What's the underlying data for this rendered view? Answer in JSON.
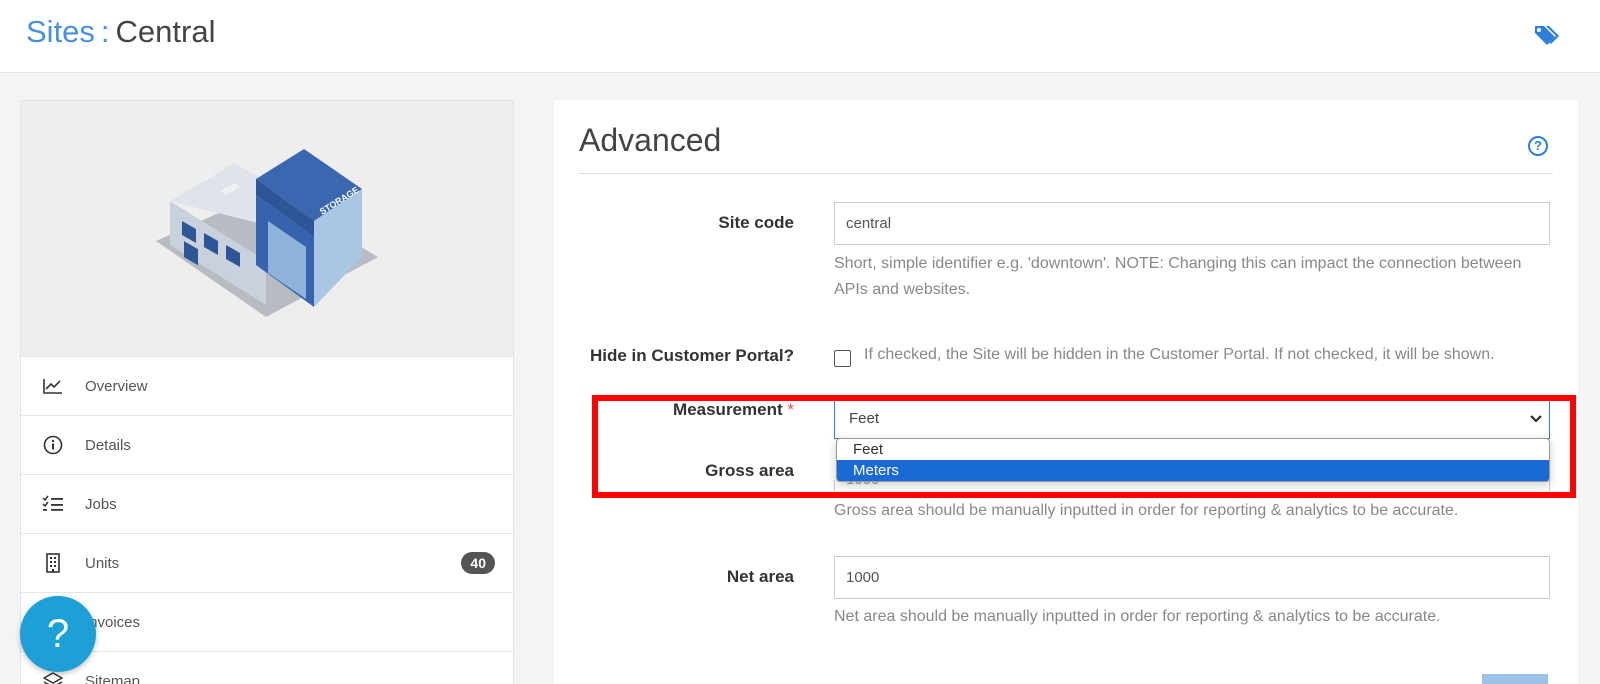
{
  "header": {
    "crumb": "Sites",
    "separator": ":",
    "current": "Central",
    "tag_icon": "tags-icon"
  },
  "nav": {
    "items": [
      {
        "label": "Overview",
        "icon": "chart-line-icon"
      },
      {
        "label": "Details",
        "icon": "info-circle-icon"
      },
      {
        "label": "Jobs",
        "icon": "checklist-icon"
      },
      {
        "label": "Units",
        "icon": "building-icon",
        "badge": "40"
      },
      {
        "label": "Invoices",
        "icon": "invoice-icon"
      },
      {
        "label": "Sitemap",
        "icon": "layers-icon"
      }
    ]
  },
  "help_fab": {
    "label": "?"
  },
  "panel": {
    "title": "Advanced",
    "help_icon": "?",
    "site_code": {
      "label": "Site code",
      "value": "central",
      "hint": "Short, simple identifier e.g. 'downtown'. NOTE: Changing this can impact the connection between APIs and websites."
    },
    "hide_portal": {
      "label": "Hide in Customer Portal?",
      "checked": false,
      "hint": "If checked, the Site will be hidden in the Customer Portal. If not checked, it will be shown."
    },
    "measurement": {
      "label": "Measurement",
      "required": "*",
      "value": "Feet",
      "options": [
        "Feet",
        "Meters"
      ],
      "highlighted": "Meters"
    },
    "gross_area": {
      "label": "Gross area",
      "value": "1000",
      "hint": "Gross area should be manually inputted in order for reporting & analytics to be accurate."
    },
    "net_area": {
      "label": "Net area",
      "value": "1000",
      "hint": "Net area should be manually inputted in order for reporting & analytics to be accurate."
    }
  },
  "colors": {
    "accent": "#4a90e2",
    "highlight": "#ff0000",
    "selected_option": "#1a6ad6",
    "fab": "#1ea0d6"
  }
}
